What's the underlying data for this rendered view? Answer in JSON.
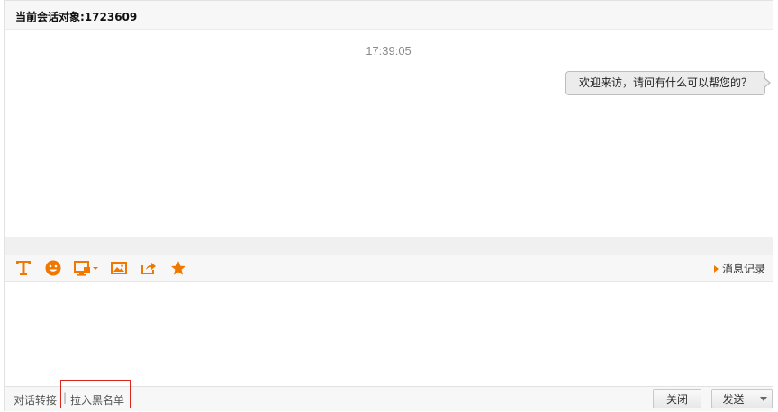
{
  "header": {
    "title": "当前会话对象:1723609"
  },
  "chat": {
    "timestamp": "17:39:05",
    "messages": [
      {
        "text": "欢迎来访，请问有什么可以帮您的？"
      }
    ]
  },
  "toolbar": {
    "icons": [
      "font-icon",
      "emoji-icon",
      "screenshot-icon",
      "image-icon",
      "share-icon",
      "star-icon"
    ],
    "history_label": "消息记录",
    "accent_color": "#f07800"
  },
  "input": {
    "value": "",
    "placeholder": ""
  },
  "footer": {
    "transfer_label": "对话转接",
    "separator": "|",
    "blacklist_label": "拉入黑名单",
    "close_label": "关闭",
    "send_label": "发送"
  }
}
